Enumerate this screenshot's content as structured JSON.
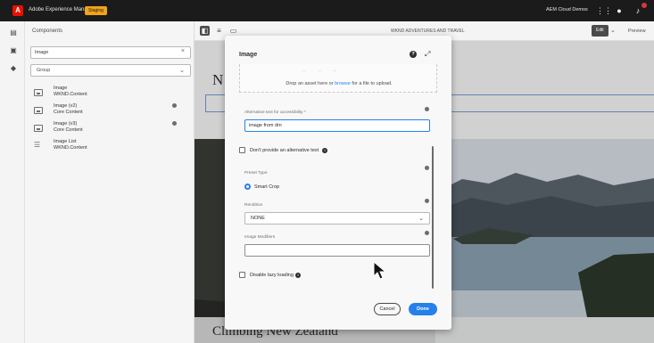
{
  "app": {
    "title": "Adobe Experience Manager",
    "environment_badge": "Staging",
    "org_name": "AEM Cloud Demos"
  },
  "rail": {
    "icons": [
      "layers-icon",
      "components-icon",
      "assets-icon"
    ]
  },
  "components_panel": {
    "title": "Components",
    "search_value": "Image",
    "group_value": "Group",
    "items": [
      {
        "name": "Image",
        "group": "WKND.Content",
        "has_info": false,
        "icon": "image-icon"
      },
      {
        "name": "Image (v2)",
        "group": "Core Content",
        "has_info": true,
        "icon": "image-icon"
      },
      {
        "name": "Image (v3)",
        "group": "Core Content",
        "has_info": true,
        "icon": "image-icon"
      },
      {
        "name": "Image List",
        "group": "WKND.Content",
        "has_info": false,
        "icon": "list-icon"
      }
    ]
  },
  "editor_toolbar": {
    "page_name": "WKND ADVENTURES AND TRAVEL",
    "mode_label": "Edit",
    "preview_label": "Preview"
  },
  "page_canvas": {
    "heading_fragment": "N",
    "article_heading": "Climbing New Zealand"
  },
  "dialog": {
    "title": "Image",
    "dropzone_text_before": "Drop an asset here or ",
    "dropzone_link": "browse",
    "dropzone_text_after": " for a file to upload.",
    "alt_label": "Alternative text for accessibility *",
    "alt_value": "image from dm",
    "no_alt_label": "Don't provide an alternative text",
    "no_alt_checked": false,
    "preset_type_label": "Preset Type",
    "preset_option": "Smart Crop",
    "preset_selected": true,
    "rendition_label": "Rendition",
    "rendition_value": "NONE",
    "modifiers_label": "Image Modifiers",
    "modifiers_value": "",
    "lazy_label": "Disable lazy loading",
    "lazy_checked": false,
    "cancel_label": "Cancel",
    "done_label": "Done"
  },
  "colors": {
    "topbar": "#1b1b1b",
    "accent_blue": "#2680eb",
    "adobe_red": "#eb1000",
    "staging_badge": "#f0a31b"
  }
}
